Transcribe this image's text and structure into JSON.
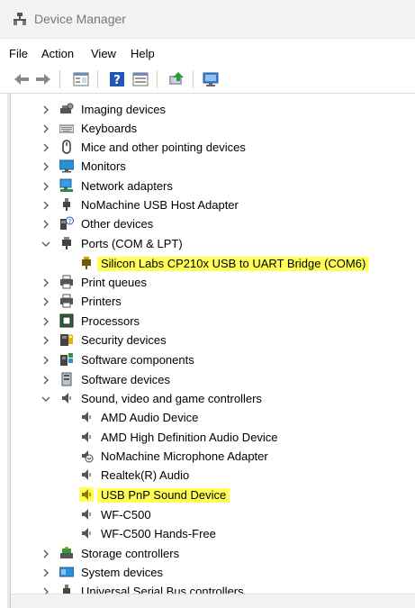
{
  "window": {
    "title": "Device Manager"
  },
  "menu": {
    "items": [
      "File",
      "Action",
      "View",
      "Help"
    ]
  },
  "tree": {
    "categories": [
      {
        "label": "Imaging devices",
        "icon": "imaging-icon",
        "expanded": false
      },
      {
        "label": "Keyboards",
        "icon": "keyboard-icon",
        "expanded": false
      },
      {
        "label": "Mice and other pointing devices",
        "icon": "mouse-icon",
        "expanded": false
      },
      {
        "label": "Monitors",
        "icon": "monitor-icon",
        "expanded": false
      },
      {
        "label": "Network adapters",
        "icon": "network-adapter-icon",
        "expanded": false
      },
      {
        "label": "NoMachine USB Host Adapter",
        "icon": "usb-icon",
        "expanded": false
      },
      {
        "label": "Other devices",
        "icon": "unknown-device-icon",
        "expanded": false
      },
      {
        "label": "Ports (COM & LPT)",
        "icon": "port-icon",
        "expanded": true,
        "children": [
          {
            "label": "Silicon Labs CP210x USB to UART Bridge (COM6)",
            "icon": "port-device-icon",
            "highlighted": true
          }
        ]
      },
      {
        "label": "Print queues",
        "icon": "print-queue-icon",
        "expanded": false
      },
      {
        "label": "Printers",
        "icon": "printer-icon",
        "expanded": false
      },
      {
        "label": "Processors",
        "icon": "processor-icon",
        "expanded": false
      },
      {
        "label": "Security devices",
        "icon": "security-device-icon",
        "expanded": false
      },
      {
        "label": "Software components",
        "icon": "software-component-icon",
        "expanded": false
      },
      {
        "label": "Software devices",
        "icon": "software-device-icon",
        "expanded": false
      },
      {
        "label": "Sound, video and game controllers",
        "icon": "speaker-icon",
        "expanded": true,
        "children": [
          {
            "label": "AMD Audio Device",
            "icon": "speaker-icon",
            "highlighted": false
          },
          {
            "label": "AMD High Definition Audio Device",
            "icon": "speaker-icon",
            "highlighted": false
          },
          {
            "label": "NoMachine Microphone Adapter",
            "icon": "microphone-icon",
            "highlighted": false
          },
          {
            "label": "Realtek(R) Audio",
            "icon": "speaker-icon",
            "highlighted": false
          },
          {
            "label": "USB PnP Sound Device",
            "icon": "speaker-icon",
            "highlighted": true
          },
          {
            "label": "WF-C500",
            "icon": "speaker-icon",
            "highlighted": false
          },
          {
            "label": "WF-C500 Hands-Free",
            "icon": "speaker-icon",
            "highlighted": false
          }
        ]
      },
      {
        "label": "Storage controllers",
        "icon": "storage-controller-icon",
        "expanded": false
      },
      {
        "label": "System devices",
        "icon": "system-device-icon",
        "expanded": false
      },
      {
        "label": "Universal Serial Bus controllers",
        "icon": "usb-controller-icon",
        "expanded": false
      }
    ]
  },
  "colors": {
    "highlight": "#ffff55"
  }
}
